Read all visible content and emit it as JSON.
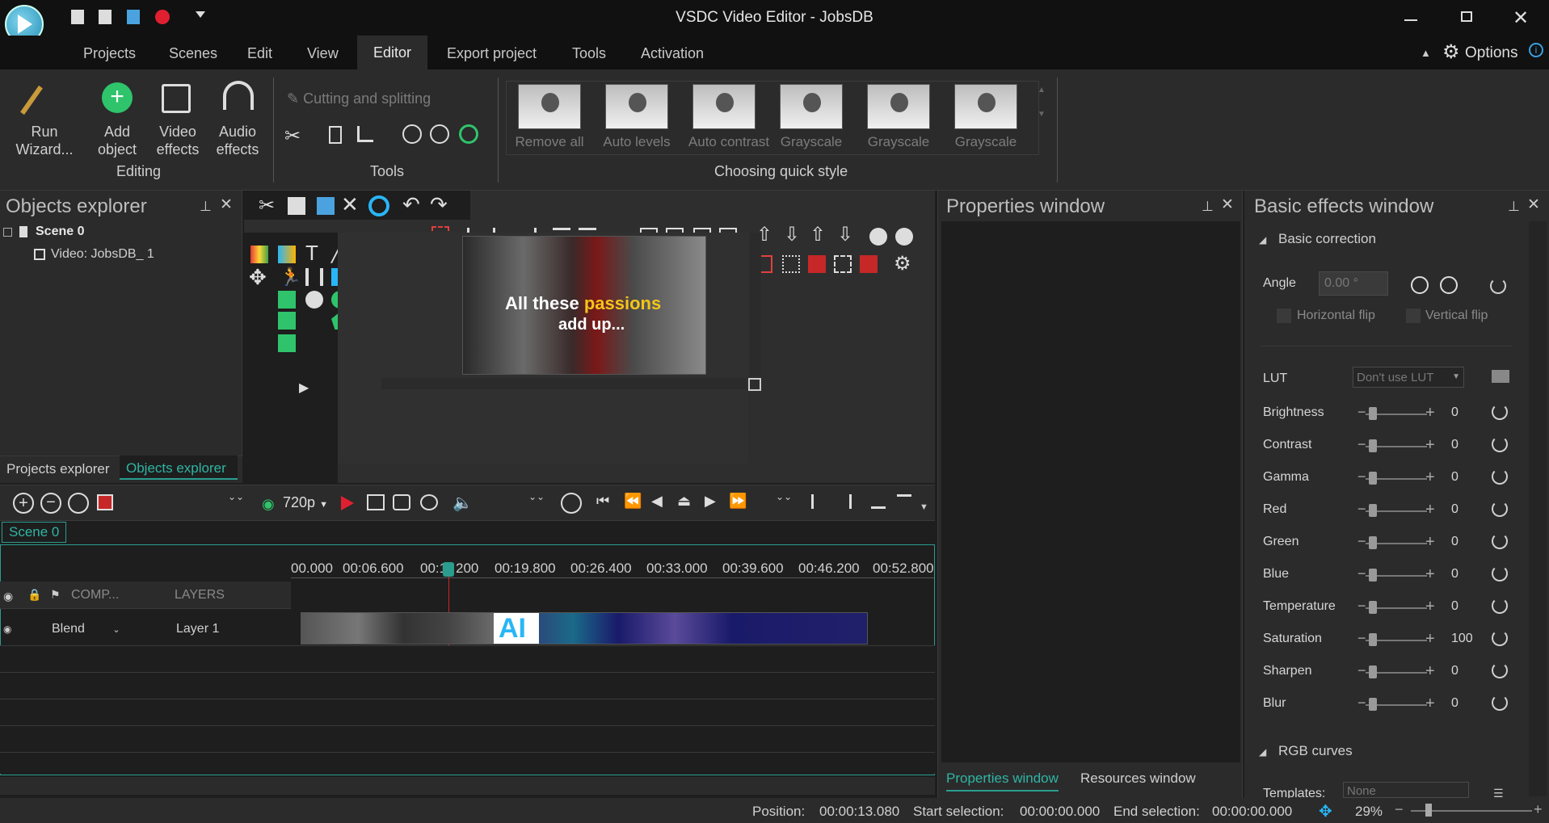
{
  "app": {
    "title": "VSDC Video Editor - JobsDB"
  },
  "menu": [
    "Projects",
    "Scenes",
    "Edit",
    "View",
    "Editor",
    "Export project",
    "Tools",
    "Activation"
  ],
  "active_menu": "Editor",
  "options_label": "Options",
  "ribbon": {
    "editing": {
      "run_wizard": "Run\nWizard...",
      "add_object": "Add\nobject",
      "video_effects": "Video\neffects",
      "audio_effects": "Audio\neffects",
      "label": "Editing"
    },
    "tools": {
      "cutting": "Cutting and splitting",
      "label": "Tools"
    },
    "quick_style": {
      "label": "Choosing quick style",
      "items": [
        "Remove all",
        "Auto levels",
        "Auto contrast",
        "Grayscale",
        "Grayscale",
        "Grayscale"
      ]
    }
  },
  "objects_explorer": {
    "title": "Objects explorer",
    "scene": "Scene 0",
    "video": "Video: JobsDB_ 1",
    "tabs": [
      "Projects explorer",
      "Objects explorer"
    ]
  },
  "preview": {
    "caption_white": "All these",
    "caption_yellow": "passions",
    "caption_line2": "add up..."
  },
  "properties": {
    "title": "Properties window",
    "tabs": [
      "Properties window",
      "Resources window"
    ]
  },
  "basic_effects": {
    "title": "Basic effects window",
    "basic_correction": "Basic correction",
    "angle_label": "Angle",
    "angle_value": "0.00 °",
    "horizontal_flip": "Horizontal flip",
    "vertical_flip": "Vertical flip",
    "lut_label": "LUT",
    "lut_value": "Don't use LUT",
    "rows": [
      {
        "label": "Brightness",
        "value": "0"
      },
      {
        "label": "Contrast",
        "value": "0"
      },
      {
        "label": "Gamma",
        "value": "0"
      },
      {
        "label": "Red",
        "value": "0"
      },
      {
        "label": "Green",
        "value": "0"
      },
      {
        "label": "Blue",
        "value": "0"
      },
      {
        "label": "Temperature",
        "value": "0"
      },
      {
        "label": "Saturation",
        "value": "100"
      },
      {
        "label": "Sharpen",
        "value": "0"
      },
      {
        "label": "Blur",
        "value": "0"
      }
    ],
    "rgb_curves": "RGB curves",
    "templates_label": "Templates:",
    "templates_value": "None"
  },
  "timeline": {
    "resolution": "720p",
    "scene_tab": "Scene 0",
    "ticks": [
      "00.000",
      "00:06.600",
      "00:1",
      "200",
      "00:19.800",
      "00:26.400",
      "00:33.000",
      "00:39.600",
      "00:46.200",
      "00:52.800"
    ],
    "header_comp": "COMP...",
    "header_layers": "LAYERS",
    "blend": "Blend",
    "layer": "Layer 1",
    "clip_text": "AI"
  },
  "status": {
    "position_label": "Position:",
    "position": "00:00:13.080",
    "start_label": "Start selection:",
    "start": "00:00:00.000",
    "end_label": "End selection:",
    "end": "00:00:00.000",
    "zoom": "29%"
  }
}
